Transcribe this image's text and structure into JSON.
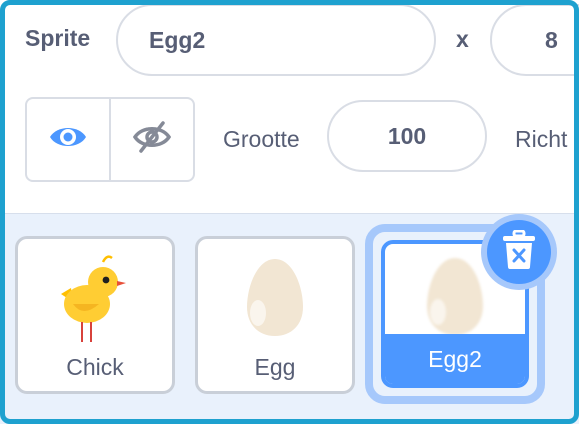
{
  "sprite_info": {
    "sprite_label": "Sprite",
    "sprite_name_value": "Egg2",
    "x_label": "x",
    "x_value": "8",
    "size_label": "Grootte",
    "size_value": "100",
    "direction_label": "Richt",
    "show_icon": "eye-icon",
    "hide_icon": "eye-slash-icon"
  },
  "sprites": [
    {
      "name": "Chick",
      "icon": "chick-icon",
      "selected": false
    },
    {
      "name": "Egg",
      "icon": "egg-icon",
      "selected": false
    },
    {
      "name": "Egg2",
      "icon": "egg-icon",
      "selected": true
    }
  ],
  "delete_icon": "trash-icon",
  "colors": {
    "accent": "#4c97ff",
    "accent_light": "#a6c8fb",
    "frame": "#1ea1cf",
    "text": "#575e75",
    "list_background": "#e9f1fc"
  }
}
